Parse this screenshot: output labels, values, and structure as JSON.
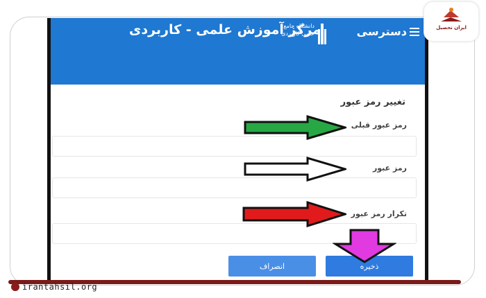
{
  "header": {
    "title": "مرکز آموزش علمی - کاربردی",
    "menu_label": "دسترسی",
    "logo_text": "دانشگاه جامع علمی کاربردی"
  },
  "form": {
    "heading": "تغییر رمز عبور",
    "old_password_label": "رمز عبور قبلی",
    "new_password_label": "رمز عبور",
    "repeat_password_label": "تکرار رمز عبور",
    "old_password_value": "",
    "new_password_value": "",
    "repeat_password_value": ""
  },
  "buttons": {
    "save_label": "ذخیره",
    "cancel_label": "انصراف"
  },
  "annotations": {
    "arrow_colors": [
      "#27a844",
      "#ffffff",
      "#e11b1b",
      "#e13ae0"
    ]
  },
  "footer": {
    "site": "irantahsil.org",
    "brand": "ایران تحصیل"
  },
  "colors": {
    "appbar": "#1f78d1",
    "button": "#2f7be0",
    "brand": "#7a1a1a"
  }
}
